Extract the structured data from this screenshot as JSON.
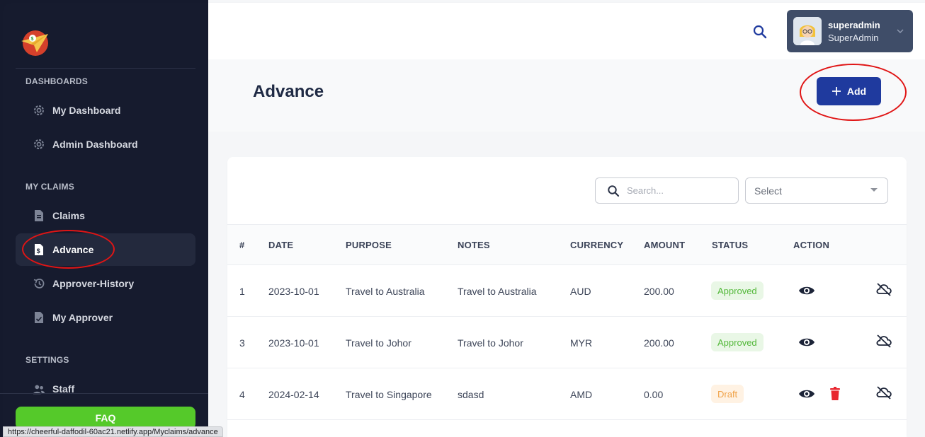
{
  "sidebar": {
    "sections": [
      {
        "title": "DASHBOARDS"
      },
      {
        "title": "MY CLAIMS"
      },
      {
        "title": "SETTINGS"
      }
    ],
    "items": [
      {
        "label": "My Dashboard",
        "icon": "gear-icon"
      },
      {
        "label": "Admin Dashboard",
        "icon": "gear-icon"
      },
      {
        "label": "Claims",
        "icon": "document-icon"
      },
      {
        "label": "Advance",
        "icon": "dollar-file-icon",
        "active": true
      },
      {
        "label": "Approver-History",
        "icon": "history-icon"
      },
      {
        "label": "My Approver",
        "icon": "check-file-icon"
      },
      {
        "label": "Staff",
        "icon": "users-icon"
      }
    ],
    "faq_label": "FAQ"
  },
  "status_url": "https://cheerful-daffodil-60ac21.netlify.app/Myclaims/advance",
  "header": {
    "user_name": "superadmin",
    "user_role": "SuperAdmin"
  },
  "page": {
    "title": "Advance",
    "add_label": "Add"
  },
  "filters": {
    "search_placeholder": "Search...",
    "select_value": "Select"
  },
  "table": {
    "columns": [
      "#",
      "DATE",
      "PURPOSE",
      "NOTES",
      "CURRENCY",
      "AMOUNT",
      "STATUS",
      "ACTION"
    ],
    "rows": [
      {
        "id": "1",
        "date": "2023-10-01",
        "purpose": "Travel to Australia",
        "notes": "Travel to Australia",
        "currency": "AUD",
        "amount": "200.00",
        "status": "Approved"
      },
      {
        "id": "3",
        "date": "2023-10-01",
        "purpose": "Travel to Johor",
        "notes": "Travel to Johor",
        "currency": "MYR",
        "amount": "200.00",
        "status": "Approved"
      },
      {
        "id": "4",
        "date": "2024-02-14",
        "purpose": "Travel to Singapore",
        "notes": "sdasd",
        "currency": "AMD",
        "amount": "0.00",
        "status": "Draft"
      }
    ]
  },
  "colors": {
    "sidebar_bg": "#161b2e",
    "primary": "#1f3a9e",
    "faq": "#55c92a",
    "highlight": "#e01515"
  }
}
